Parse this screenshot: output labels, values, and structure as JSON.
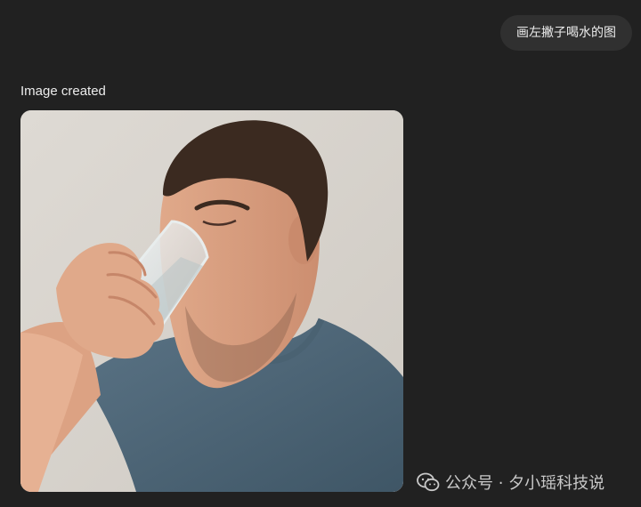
{
  "conversation": {
    "user_message": "画左撇子喝水的图",
    "assistant_status": "Image created",
    "image_alt": "Image created"
  },
  "watermark": {
    "icon": "wechat-icon",
    "text": "公众号 · 夕小瑶科技说"
  },
  "colors": {
    "background": "#212121",
    "bubble": "#303030",
    "text": "#ececec"
  }
}
